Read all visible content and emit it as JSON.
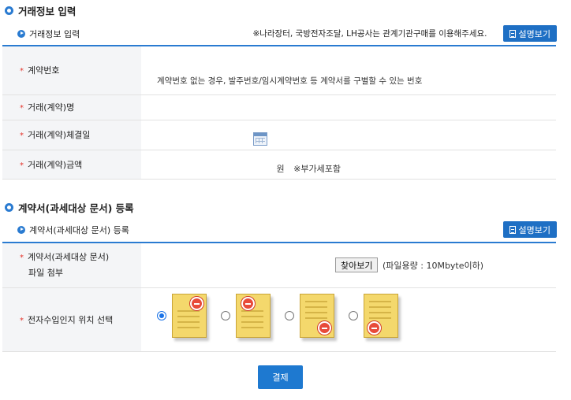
{
  "section1": {
    "title": "거래정보 입력",
    "subtitle": "거래정보 입력",
    "notice": "※나라장터, 국방전자조달, LH공사는 관계기관구매를 이용해주세요.",
    "guide_button": "설명보기",
    "rows": [
      {
        "label": "계약번호",
        "hint": "계약번호 없는 경우, 발주번호/임시계약번호 등 계약서를 구별할 수 있는 번호"
      },
      {
        "label": "거래(계약)명"
      },
      {
        "label": "거래(계약)체결일"
      },
      {
        "label": "거래(계약)금액",
        "unit": "원",
        "note": "※부가세포함"
      }
    ]
  },
  "section2": {
    "title": "계약서(과세대상 문서) 등록",
    "subtitle": "계약서(과세대상 문서) 등록",
    "guide_button": "설명보기",
    "file_label_line1": "계약서(과세대상 문서)",
    "file_label_line2": "파일 첨부",
    "file_button": "찾아보기",
    "file_note": "(파일용량 : 10Mbyte이하)",
    "position_label": "전자수입인지 위치 선택",
    "selected_position": 1
  },
  "submit_button": "결제",
  "colors": {
    "accent": "#2a7bd1",
    "required": "#e5332a",
    "button": "#1e6fc4"
  }
}
